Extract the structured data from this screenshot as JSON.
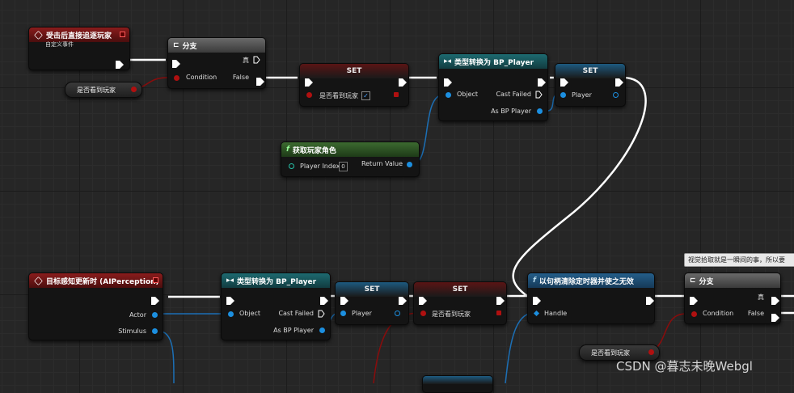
{
  "nodes": {
    "event1": {
      "title": "受击后直接追逐玩家",
      "subtitle": "自定义事件"
    },
    "branch1": {
      "title": "分支",
      "condition": "Condition",
      "true_label": "真",
      "false_label": "False"
    },
    "get_var1": {
      "label": "是否看到玩家"
    },
    "set1": {
      "title": "SET",
      "var_label": "是否看到玩家",
      "checked": "✓"
    },
    "cast1": {
      "title": "类型转换为 BP_Player",
      "object": "Object",
      "cast_failed": "Cast Failed",
      "as": "As BP Player"
    },
    "set2": {
      "title": "SET",
      "var_label": "Player"
    },
    "getplayer": {
      "title": "获取玩家角色",
      "index_label": "Player Index",
      "index_value": "0",
      "return_label": "Return Value"
    },
    "event2": {
      "title": "目标感知更新时 (AIPerception)",
      "actor": "Actor",
      "stimulus": "Stimulus"
    },
    "cast2": {
      "title": "类型转换为 BP_Player",
      "object": "Object",
      "cast_failed": "Cast Failed",
      "as": "As BP Player"
    },
    "set3": {
      "title": "SET",
      "var_label": "Player"
    },
    "set4": {
      "title": "SET",
      "var_label": "是否看到玩家"
    },
    "clear": {
      "title": "以句柄清除定时器并使之无效",
      "handle": "Handle"
    },
    "branch2": {
      "title": "分支",
      "condition": "Condition",
      "true_label": "真",
      "false_label": "False"
    },
    "get_var2": {
      "label": "是否看到玩家"
    }
  },
  "comment": "视觉拾取就是一瞬间的事，所以要",
  "watermark": "CSDN @暮志未晚Webgl",
  "colors": {
    "exec": "#ffffff",
    "bool": "#b01010",
    "object": "#1c8fe0",
    "int": "#27c2a8"
  }
}
